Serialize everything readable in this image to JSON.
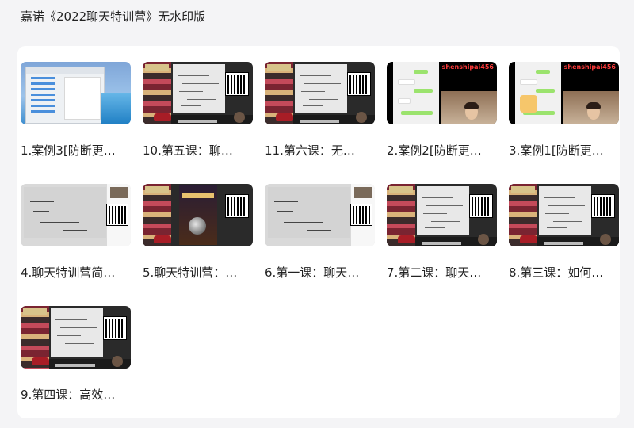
{
  "page": {
    "title": "嘉诺《2022聊天特训营》无水印版"
  },
  "videos": [
    {
      "title": "1.案例3[防断更…",
      "thumb": "desktop"
    },
    {
      "title": "10.第五课：聊…",
      "thumb": "class"
    },
    {
      "title": "11.第六课：无…",
      "thumb": "class"
    },
    {
      "title": "2.案例2[防断更…",
      "thumb": "chat",
      "watermark": "shenshipai456"
    },
    {
      "title": "3.案例1[防断更…",
      "thumb": "chat",
      "watermark": "shenshipai456"
    },
    {
      "title": "4.聊天特训营简…",
      "thumb": "mind"
    },
    {
      "title": "5.聊天特训营：…",
      "thumb": "poster"
    },
    {
      "title": "6.第一课：聊天…",
      "thumb": "mind"
    },
    {
      "title": "7.第二课：聊天…",
      "thumb": "class"
    },
    {
      "title": "8.第三课：如何…",
      "thumb": "class"
    },
    {
      "title": "9.第四课：高效…",
      "thumb": "class"
    }
  ]
}
